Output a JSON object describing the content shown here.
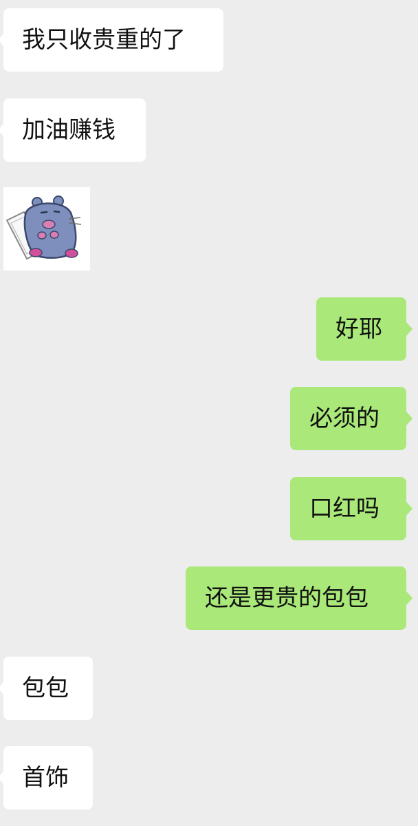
{
  "conversation": {
    "messages": [
      {
        "side": "left",
        "text": "我只收贵重的了"
      },
      {
        "side": "left",
        "text": "加油赚钱"
      },
      {
        "side": "left",
        "type": "sticker",
        "sticker": "sleeping-hamster-with-pillow"
      },
      {
        "side": "right",
        "text": "好耶"
      },
      {
        "side": "right",
        "text": "必须的"
      },
      {
        "side": "right",
        "text": "口红吗"
      },
      {
        "side": "right",
        "text": "还是更贵的包包"
      },
      {
        "side": "left",
        "text": "包包"
      },
      {
        "side": "left",
        "text": "首饰"
      }
    ]
  },
  "colors": {
    "background": "#ededed",
    "incoming_bubble": "#ffffff",
    "outgoing_bubble": "#a9e879",
    "text": "#111111"
  }
}
